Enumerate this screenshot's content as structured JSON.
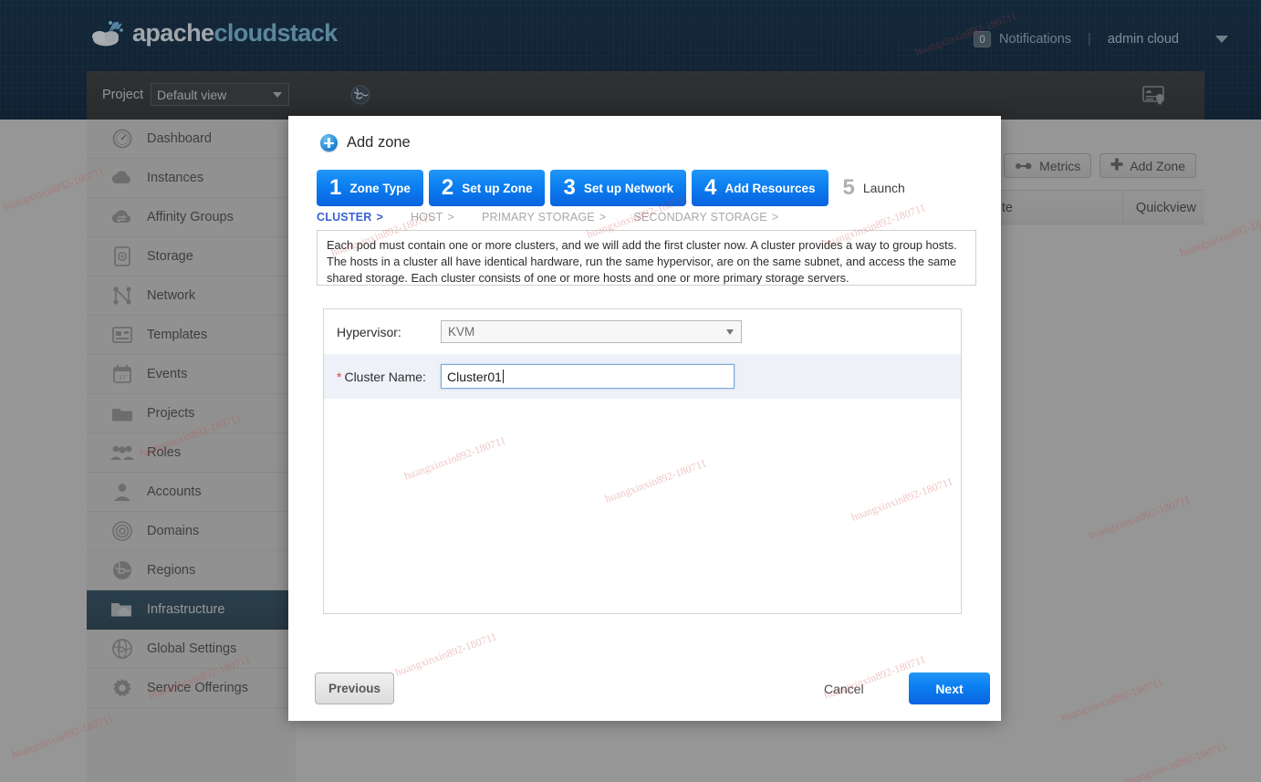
{
  "header": {
    "brand_a": "apache",
    "brand_b": "cloudstack",
    "notifications_count": "0",
    "notifications_label": "Notifications",
    "separator": "|",
    "user": "admin cloud",
    "caret_icon": "chevron-down-icon",
    "logo_icon": "cloud-logo-icon"
  },
  "projectbar": {
    "label": "Project",
    "selected_view": "Default view",
    "globe_icon": "globe-icon",
    "cert_icon": "certificate-icon"
  },
  "sidebar": {
    "items": [
      {
        "label": "Dashboard",
        "icon": "gauge-icon"
      },
      {
        "label": "Instances",
        "icon": "cloud-icon"
      },
      {
        "label": "Affinity Groups",
        "icon": "cloud-sync-icon"
      },
      {
        "label": "Storage",
        "icon": "disk-icon"
      },
      {
        "label": "Network",
        "icon": "network-nodes-icon"
      },
      {
        "label": "Templates",
        "icon": "template-icon"
      },
      {
        "label": "Events",
        "icon": "calendar-icon"
      },
      {
        "label": "Projects",
        "icon": "folder-icon"
      },
      {
        "label": "Roles",
        "icon": "users-icon"
      },
      {
        "label": "Accounts",
        "icon": "user-icon"
      },
      {
        "label": "Domains",
        "icon": "target-icon"
      },
      {
        "label": "Regions",
        "icon": "globe-icon"
      },
      {
        "label": "Infrastructure",
        "icon": "folder-cloud-icon",
        "active": true
      },
      {
        "label": "Global Settings",
        "icon": "world-icon"
      },
      {
        "label": "Service Offerings",
        "icon": "gear-icon"
      }
    ]
  },
  "content": {
    "search_icon": "search-icon",
    "metrics_label": "Metrics",
    "metrics_icon": "metrics-icon",
    "add_zone_label": "Add Zone",
    "add_zone_icon": "plus-icon",
    "col_state": "te",
    "col_quickview": "Quickview"
  },
  "modal": {
    "title": "Add zone",
    "title_icon": "add-circle-icon",
    "steps": [
      {
        "num": "1",
        "label": "Zone Type",
        "active": true
      },
      {
        "num": "2",
        "label": "Set up Zone",
        "active": true
      },
      {
        "num": "3",
        "label": "Set up Network",
        "active": true
      },
      {
        "num": "4",
        "label": "Add Resources",
        "active": true
      },
      {
        "num": "5",
        "label": "Launch",
        "active": false
      }
    ],
    "substeps": [
      {
        "label": "CLUSTER",
        "active": true
      },
      {
        "label": "HOST",
        "active": false
      },
      {
        "label": "PRIMARY STORAGE",
        "active": false
      },
      {
        "label": "SECONDARY STORAGE",
        "active": false
      }
    ],
    "substep_sep": ">",
    "description": "Each pod must contain one or more clusters, and we will add the first cluster now. A cluster provides a way to group hosts. The hosts in a cluster all have identical hardware, run the same hypervisor, are on the same subnet, and access the same shared storage. Each cluster consists of one or more hosts and one or more primary storage servers.",
    "form": {
      "hypervisor_label": "Hypervisor:",
      "hypervisor_value": "KVM",
      "cluster_required_mark": "*",
      "cluster_label": "Cluster Name:",
      "cluster_value": "Cluster01",
      "cluster_placeholder": ""
    },
    "footer": {
      "previous_label": "Previous",
      "cancel_label": "Cancel",
      "next_label": "Next"
    }
  },
  "watermarks": {
    "text": "huangxinxin892-180711"
  },
  "colors": {
    "accent_blue": "#0b7ff0",
    "header_navy": "#0d263d",
    "active_sidebar": "#0f3e5b",
    "required_red": "#e04040",
    "substep_active": "#3a5fd0"
  }
}
